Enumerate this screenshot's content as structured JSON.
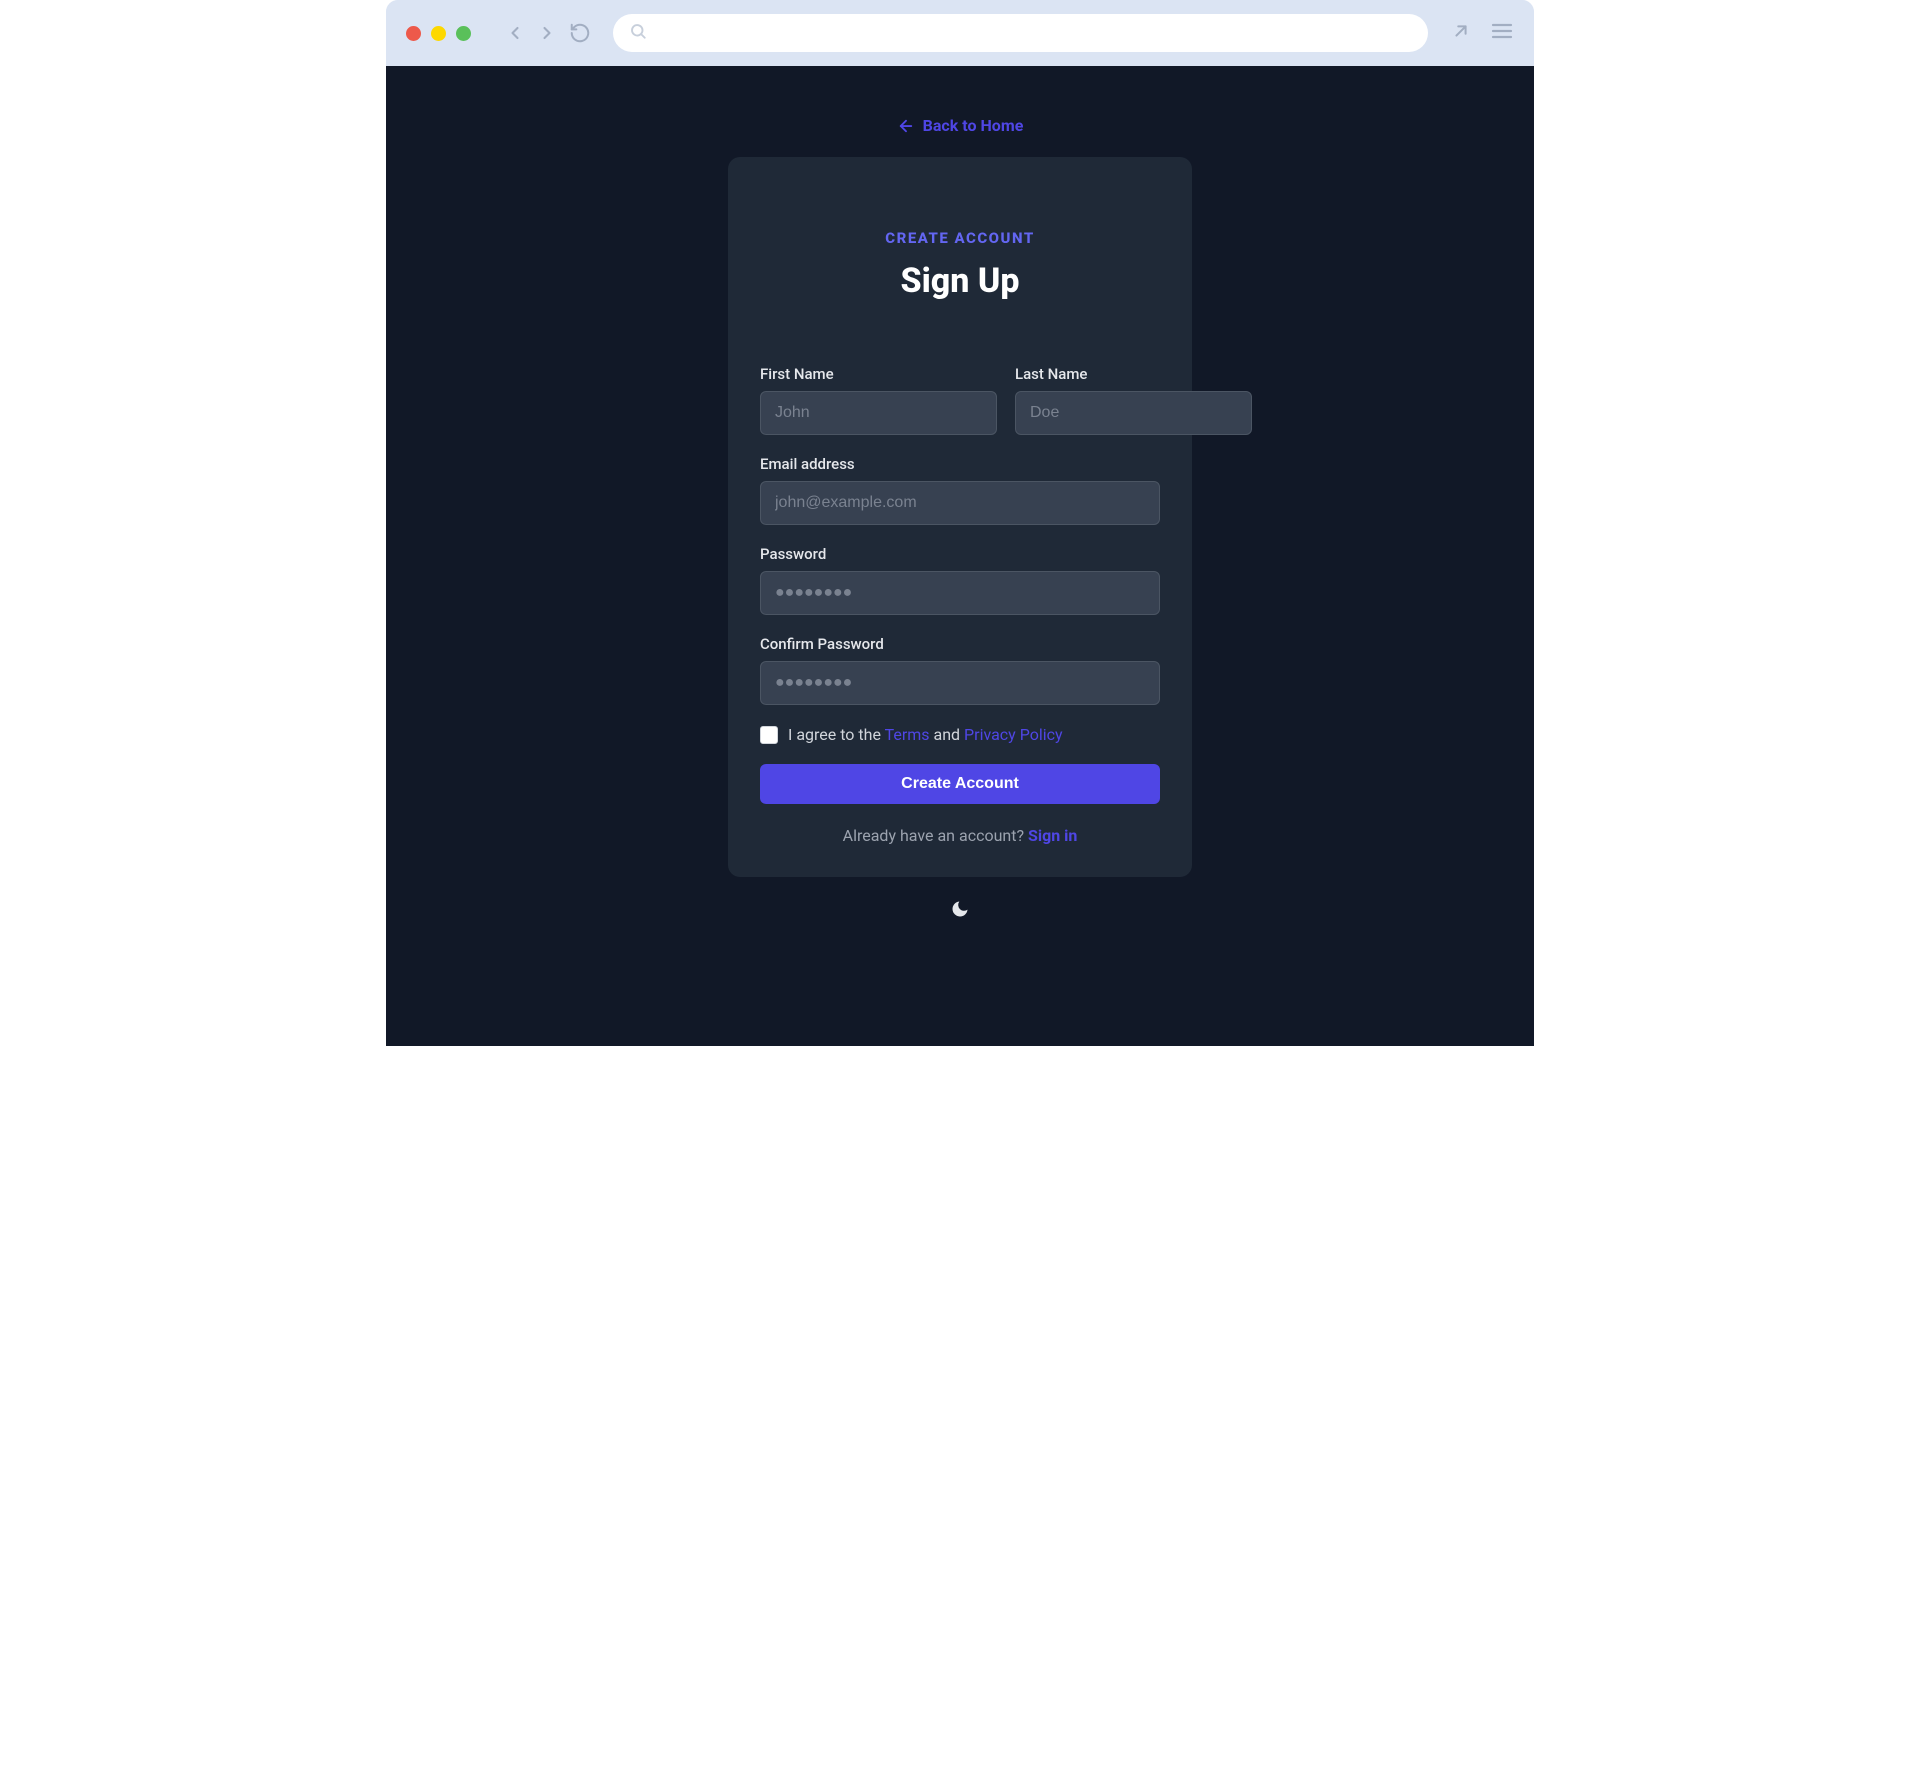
{
  "backLink": {
    "label": "Back to Home"
  },
  "header": {
    "kicker": "CREATE ACCOUNT",
    "title": "Sign Up"
  },
  "form": {
    "firstName": {
      "label": "First Name",
      "placeholder": "John",
      "value": ""
    },
    "lastName": {
      "label": "Last Name",
      "placeholder": "Doe",
      "value": ""
    },
    "email": {
      "label": "Email address",
      "placeholder": "john@example.com",
      "value": ""
    },
    "password": {
      "label": "Password",
      "placeholder": "●●●●●●●●",
      "value": ""
    },
    "confirm": {
      "label": "Confirm Password",
      "placeholder": "●●●●●●●●",
      "value": ""
    },
    "agree": {
      "prefix": "I agree to the ",
      "termsLabel": "Terms",
      "middle": " and ",
      "privacyLabel": "Privacy Policy"
    },
    "submitLabel": "Create Account"
  },
  "footer": {
    "prompt": "Already have an account? ",
    "signInLabel": "Sign in"
  },
  "colors": {
    "bg": "#111827",
    "card": "#1f2937",
    "input": "#374151",
    "accent": "#4f46e5"
  }
}
